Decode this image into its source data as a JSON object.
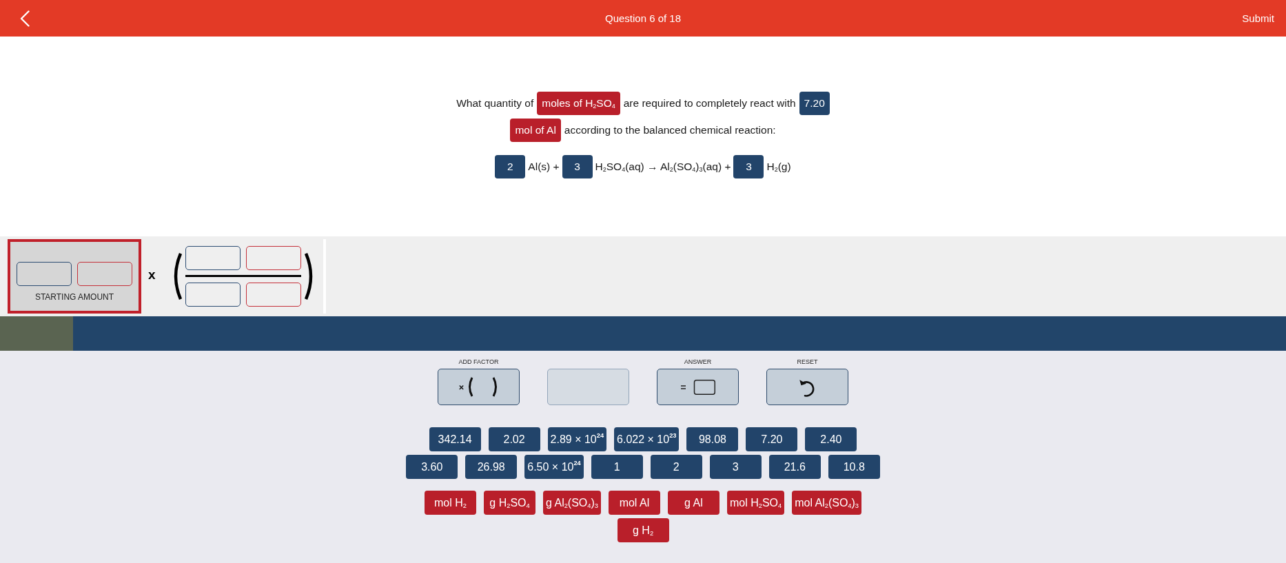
{
  "top_bar": {
    "title": "Question 6 of 18",
    "submit": "Submit"
  },
  "question": {
    "lines": [
      {
        "parts": [
          {
            "kind": "text",
            "text": "What quantity of"
          },
          {
            "kind": "unit",
            "text": "moles of H$_{2}$SO$_{4}$"
          },
          {
            "kind": "text",
            "text": "are required to completely react with"
          },
          {
            "kind": "value",
            "text": "7.20"
          }
        ]
      },
      {
        "parts": [
          {
            "kind": "unit",
            "text": "mol of Al"
          },
          {
            "kind": "text",
            "text": "according to the balanced chemical reaction:"
          }
        ]
      }
    ],
    "equation": [
      {
        "kind": "value",
        "text": "2"
      },
      {
        "kind": "text",
        "text": "Al(s) +"
      },
      {
        "kind": "value",
        "text": "3"
      },
      {
        "kind": "text",
        "text": "H$_{2}$SO$_{4}$(aq) → Al$_{2}$(SO$_{4}$)$_{3}$(aq) +"
      },
      {
        "kind": "value",
        "text": "3"
      },
      {
        "kind": "text",
        "text": "H$_{2}$(g)"
      }
    ]
  },
  "workspace": {
    "factors": [
      {
        "kind": "starting",
        "label": "STARTING AMOUNT",
        "selected": true
      },
      {
        "kind": "fraction",
        "operator": "x",
        "selected": false
      }
    ]
  },
  "controls": [
    {
      "kind": "add_factor",
      "label": "ADD FACTOR",
      "disabled": false
    },
    {
      "kind": "empty",
      "disabled": true
    },
    {
      "kind": "answer",
      "label": "ANSWER",
      "disabled": false
    },
    {
      "kind": "reset",
      "label": "RESET",
      "disabled": false
    }
  ],
  "number_tiles": [
    "342.14",
    "2.02",
    "2.89 × 10$^{24}$",
    "6.022 × 10$^{23}$",
    "98.08",
    "7.20",
    "2.40",
    "3.60",
    "26.98",
    "6.50 × 10$^{24}$",
    "1",
    "2",
    "3",
    "21.6",
    "10.8"
  ],
  "unit_tiles": [
    "mol H$_{2}$",
    "g H$_{2}$SO$_{4}$",
    "g Al$_{2}$(SO$_{4}$)$_{3}$",
    "mol Al",
    "g Al",
    "mol H$_{2}$SO$_{4}$",
    "mol Al$_{2}$(SO$_{4}$)$_{3}$",
    "g H$_{2}$"
  ]
}
